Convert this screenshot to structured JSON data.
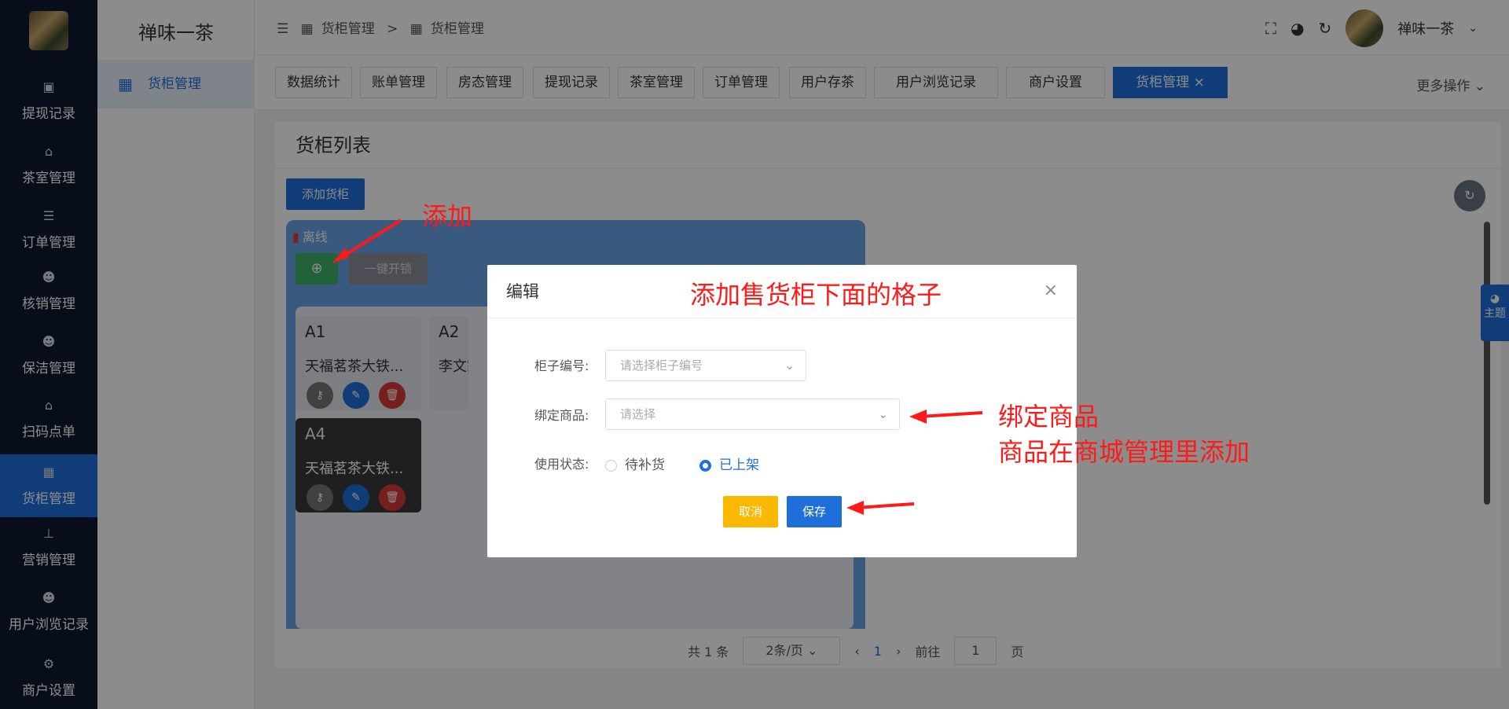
{
  "sidebar": {
    "items": [
      {
        "label": "提现记录",
        "icon": "money-icon"
      },
      {
        "label": "茶室管理",
        "icon": "home-icon"
      },
      {
        "label": "订单管理",
        "icon": "list-icon"
      },
      {
        "label": "核销管理",
        "icon": "user-check-icon"
      },
      {
        "label": "保洁管理",
        "icon": "user-clock-icon"
      },
      {
        "label": "扫码点单",
        "icon": "store-icon"
      },
      {
        "label": "货柜管理",
        "icon": "grid-icon"
      },
      {
        "label": "营销管理",
        "icon": "sitemap-icon"
      },
      {
        "label": "用户浏览记录",
        "icon": "users-icon"
      },
      {
        "label": "商户设置",
        "icon": "gear-icon"
      }
    ]
  },
  "subpanel": {
    "brand": "禅味一茶",
    "item": "货柜管理"
  },
  "topbar": {
    "crumb1": "货柜管理",
    "sep": ">",
    "crumb2": "货柜管理",
    "user": "禅味一茶"
  },
  "tabs": [
    "数据统计",
    "账单管理",
    "房态管理",
    "提现记录",
    "茶室管理",
    "订单管理",
    "用户存茶",
    "用户浏览记录",
    "商户设置",
    "货柜管理"
  ],
  "active_tab_close": "×",
  "more_ops": "更多操作",
  "card": {
    "title": "货柜列表",
    "add_btn": "添加货柜"
  },
  "cabinet": {
    "status": "离线",
    "unlock_btn": "一键开锁",
    "cells": [
      {
        "name": "A1",
        "product": "天福茗茶大铁..."
      },
      {
        "name": "A2",
        "product": "李文家"
      },
      {
        "name": "A4",
        "product": "天福茗茶大铁..."
      }
    ]
  },
  "pager": {
    "total": "共 1 条",
    "per_page": "2条/页",
    "page": "1",
    "goto": "前往",
    "goto_val": "1",
    "page_unit": "页"
  },
  "modal": {
    "title": "编辑",
    "close": "×",
    "cabinet_no_label": "柜子编号:",
    "cabinet_no_placeholder": "请选择柜子编号",
    "goods_label": "绑定商品:",
    "goods_placeholder": "请选择",
    "status_label": "使用状态:",
    "status_opt1": "待补货",
    "status_opt2": "已上架",
    "cancel": "取消",
    "save": "保存"
  },
  "annotations": {
    "add": "添加",
    "header": "添加售货柜下面的格子",
    "bind1": "绑定商品",
    "bind2": "商品在商城管理里添加"
  },
  "theme_tab": "主题",
  "colors": {
    "primary": "#1e6fd9",
    "sidebar": "#0d1b2e",
    "cancel": "#fbb800",
    "annotation": "#ff1a1a"
  }
}
